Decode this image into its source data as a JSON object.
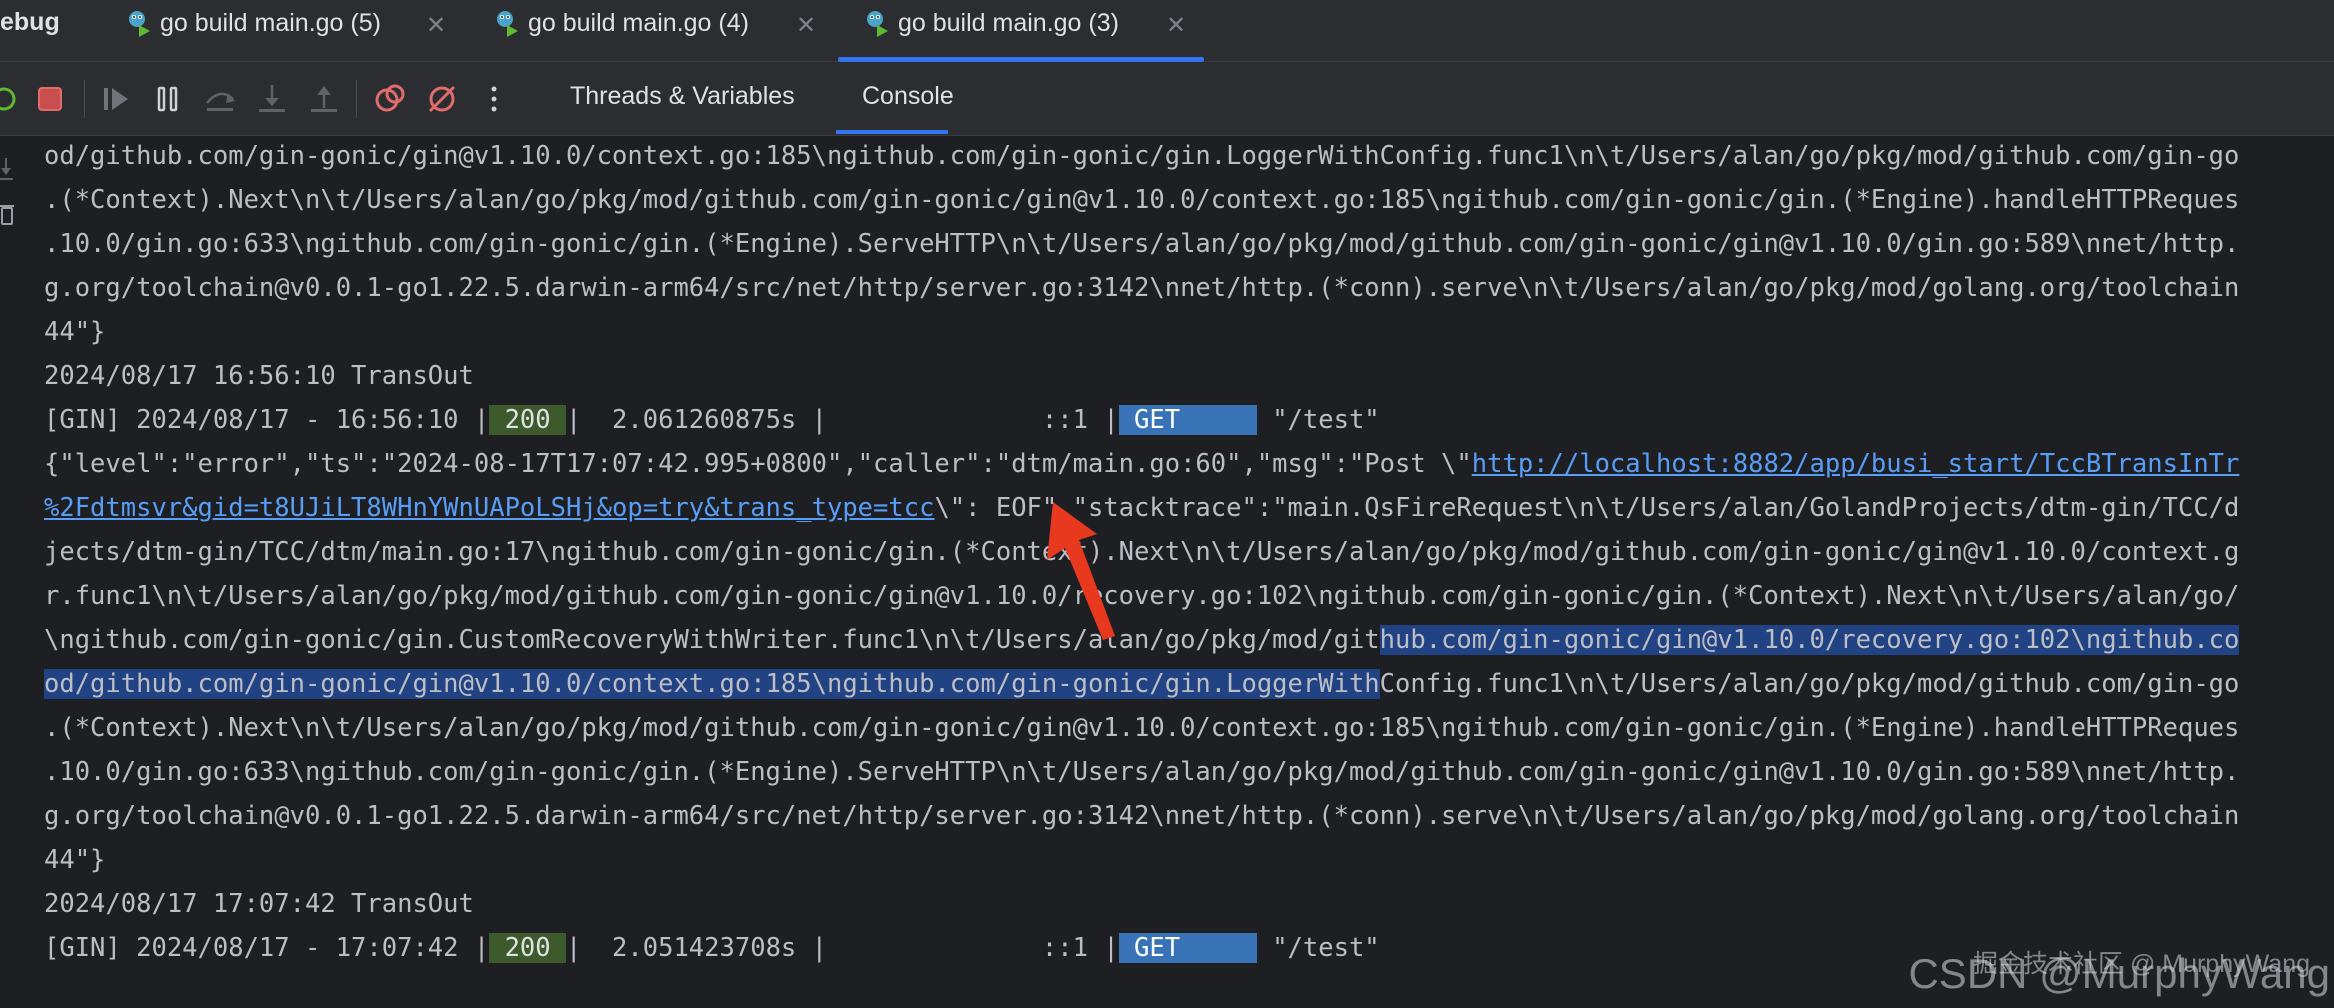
{
  "panel": {
    "title": "ebug"
  },
  "tabs": [
    {
      "label": "go build main.go (5)",
      "active": false
    },
    {
      "label": "go build main.go (4)",
      "active": false
    },
    {
      "label": "go build main.go (3)",
      "active": true
    }
  ],
  "toolbar": {
    "icons": [
      "rerun-icon",
      "stop-icon",
      "resume-icon",
      "pause-icon",
      "step-over-icon",
      "step-into-icon",
      "step-out-icon",
      "view-breakpoints-icon",
      "mute-breakpoints-icon",
      "more-icon"
    ],
    "subtabs": [
      {
        "label": "Threads & Variables",
        "active": false
      },
      {
        "label": "Console",
        "active": true
      }
    ]
  },
  "console": {
    "lines": {
      "l0": "od/github.com/gin-gonic/gin@v1.10.0/context.go:185\\ngithub.com/gin-gonic/gin.LoggerWithConfig.func1\\n\\t/Users/alan/go/pkg/mod/github.com/gin-go",
      "l1": ".(*Context).Next\\n\\t/Users/alan/go/pkg/mod/github.com/gin-gonic/gin@v1.10.0/context.go:185\\ngithub.com/gin-gonic/gin.(*Engine).handleHTTPReques",
      "l2": ".10.0/gin.go:633\\ngithub.com/gin-gonic/gin.(*Engine).ServeHTTP\\n\\t/Users/alan/go/pkg/mod/github.com/gin-gonic/gin@v1.10.0/gin.go:589\\nnet/http.",
      "l3": "g.org/toolchain@v0.0.1-go1.22.5.darwin-arm64/src/net/http/server.go:3142\\nnet/http.(*conn).serve\\n\\t/Users/alan/go/pkg/mod/golang.org/toolchain",
      "l4": "44\"}",
      "l5": "2024/08/17 16:56:10 TransOut",
      "l6": {
        "prefix": "[GIN] 2024/08/17 - 16:56:10 |",
        "status": " 200 ",
        "middle": "|  2.061260875s |              ::1 |",
        "method": " GET     ",
        "path": " \"/test\""
      },
      "l7": {
        "prefix": "{\"level\":\"error\",\"ts\":\"2024-08-17T17:07:42.995+0800\",\"caller\":\"dtm/main.go:60\",\"msg\":\"Post \\\"",
        "link": "http://localhost:8882/app/busi_start/TccBTransInTr"
      },
      "l8": {
        "link": "%2Fdtmsvr&gid=t8UJiLT8WHnYWnUAPoLSHj&op=try&trans_type=tcc",
        "rest": "\\\": EOF\",\"stacktrace\":\"main.QsFireRequest\\n\\t/Users/alan/GolandProjects/dtm-gin/TCC/d"
      },
      "l9": "jects/dtm-gin/TCC/dtm/main.go:17\\ngithub.com/gin-gonic/gin.(*Context).Next\\n\\t/Users/alan/go/pkg/mod/github.com/gin-gonic/gin@v1.10.0/context.g",
      "l10": "r.func1\\n\\t/Users/alan/go/pkg/mod/github.com/gin-gonic/gin@v1.10.0/recovery.go:102\\ngithub.com/gin-gonic/gin.(*Context).Next\\n\\t/Users/alan/go/",
      "l11": {
        "plain": "\\ngithub.com/gin-gonic/gin.CustomRecoveryWithWriter.func1\\n\\t/Users/alan/go/pkg/mod/git",
        "selected": "hub.com/gin-gonic/gin@v1.10.0/recovery.go:102\\ngithub.co"
      },
      "l12": {
        "selected": "od/github.com/gin-gonic/gin@v1.10.0/context.go:185\\ngithub.com/gin-gonic/gin.LoggerWith",
        "plain": "Config.func1\\n\\t/Users/alan/go/pkg/mod/github.com/gin-go"
      },
      "l13": ".(*Context).Next\\n\\t/Users/alan/go/pkg/mod/github.com/gin-gonic/gin@v1.10.0/context.go:185\\ngithub.com/gin-gonic/gin.(*Engine).handleHTTPReques",
      "l14": ".10.0/gin.go:633\\ngithub.com/gin-gonic/gin.(*Engine).ServeHTTP\\n\\t/Users/alan/go/pkg/mod/github.com/gin-gonic/gin@v1.10.0/gin.go:589\\nnet/http.",
      "l15": "g.org/toolchain@v0.0.1-go1.22.5.darwin-arm64/src/net/http/server.go:3142\\nnet/http.(*conn).serve\\n\\t/Users/alan/go/pkg/mod/golang.org/toolchain",
      "l16": "44\"}",
      "l17": "2024/08/17 17:07:42 TransOut",
      "l18": {
        "prefix": "[GIN] 2024/08/17 - 17:07:42 |",
        "status": " 200 ",
        "middle": "|  2.051423708s |              ::1 |",
        "method": " GET     ",
        "path": " \"/test\""
      }
    }
  },
  "watermark": {
    "text": "CSDN @MurphyWang",
    "sub": "掘金技术社区 @ MurphyWang"
  },
  "colors": {
    "background": "#1e1f22",
    "toolbar": "#2b2d30",
    "accent": "#3574f0",
    "selection": "#214283",
    "link": "#589df6",
    "status_ok": "#3d5a2c",
    "method_get": "#3873b7",
    "annotation_arrow": "#e8391f"
  }
}
